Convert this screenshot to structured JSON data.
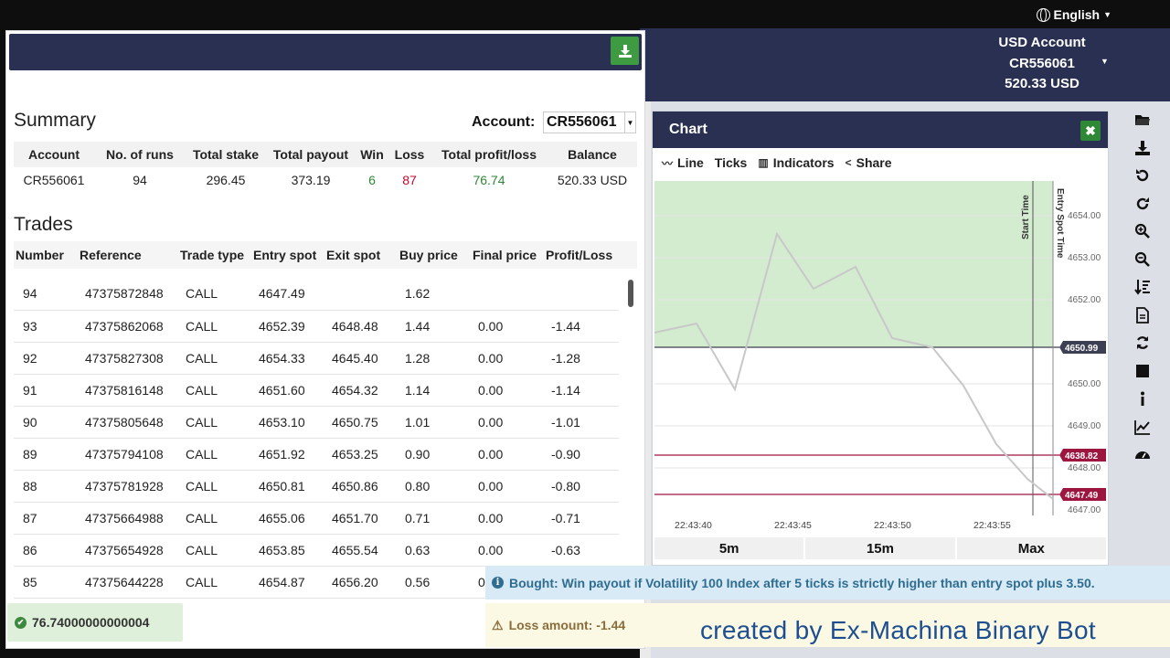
{
  "topbar": {
    "language": "English"
  },
  "account_menu": {
    "line1": "USD Account",
    "line2": "CR556061",
    "line3": "520.33 USD"
  },
  "summary": {
    "title": "Summary",
    "account_label": "Account:",
    "account_value": "CR556061",
    "columns": [
      "Account",
      "No. of runs",
      "Total stake",
      "Total payout",
      "Win",
      "Loss",
      "Total profit/loss",
      "Balance"
    ],
    "row": [
      "CR556061",
      "94",
      "296.45",
      "373.19",
      "6",
      "87",
      "76.74",
      "520.33 USD"
    ]
  },
  "trades": {
    "title": "Trades",
    "columns": [
      "Number",
      "Reference",
      "Trade type",
      "Entry spot",
      "Exit spot",
      "Buy price",
      "Final price",
      "Profit/Loss"
    ],
    "rows": [
      [
        "94",
        "47375872848",
        "CALL",
        "4647.49",
        "",
        "1.62",
        "",
        ""
      ],
      [
        "93",
        "47375862068",
        "CALL",
        "4652.39",
        "4648.48",
        "1.44",
        "0.00",
        "-1.44"
      ],
      [
        "92",
        "47375827308",
        "CALL",
        "4654.33",
        "4645.40",
        "1.28",
        "0.00",
        "-1.28"
      ],
      [
        "91",
        "47375816148",
        "CALL",
        "4651.60",
        "4654.32",
        "1.14",
        "0.00",
        "-1.14"
      ],
      [
        "90",
        "47375805648",
        "CALL",
        "4653.10",
        "4650.75",
        "1.01",
        "0.00",
        "-1.01"
      ],
      [
        "89",
        "47375794108",
        "CALL",
        "4651.92",
        "4653.25",
        "0.90",
        "0.00",
        "-0.90"
      ],
      [
        "88",
        "47375781928",
        "CALL",
        "4650.81",
        "4650.86",
        "0.80",
        "0.00",
        "-0.80"
      ],
      [
        "87",
        "47375664988",
        "CALL",
        "4655.06",
        "4651.70",
        "0.71",
        "0.00",
        "-0.71"
      ],
      [
        "86",
        "47375654928",
        "CALL",
        "4653.85",
        "4655.54",
        "0.63",
        "0.00",
        "-0.63"
      ],
      [
        "85",
        "47375644228",
        "CALL",
        "4654.87",
        "4656.20",
        "0.56",
        "0",
        ""
      ]
    ]
  },
  "profit_toast": "76.74000000000004",
  "chart": {
    "title": "Chart",
    "toolbar": [
      "Line",
      "Ticks",
      "Indicators",
      "Share"
    ],
    "ranges": [
      "5m",
      "15m",
      "Max"
    ],
    "y_ticks": [
      "4654.00",
      "4653.00",
      "4652.00",
      "4650.00",
      "4649.00",
      "4648.00",
      "4647.00"
    ],
    "x_ticks": [
      "22:43:40",
      "22:43:45",
      "22:43:50",
      "22:43:55"
    ],
    "markers": {
      "current": "4650.99",
      "barrier1": "4638.82",
      "barrier2": "4647.49"
    },
    "vlines": [
      "Start Time",
      "Entry Spot Time"
    ],
    "colors": {
      "zone": "#d3ecd0",
      "line": "#c8c8c8",
      "barrier": "#9c1640",
      "header": "#2a3052"
    }
  },
  "notifications": {
    "info": "Bought: Win payout if Volatility 100 Index after 5 ticks is strictly higher than entry spot plus 3.50.",
    "warning": "Loss amount: -1.44"
  },
  "watermark": "created by Ex-Machina Binary Bot",
  "toolbar_icons": [
    "folder-open-icon",
    "download-icon",
    "undo-icon",
    "redo-icon",
    "zoom-in-icon",
    "zoom-out-icon",
    "sort-icon",
    "file-icon",
    "refresh-icon",
    "stop-icon",
    "info-icon",
    "line-chart-icon",
    "dashboard-icon"
  ]
}
